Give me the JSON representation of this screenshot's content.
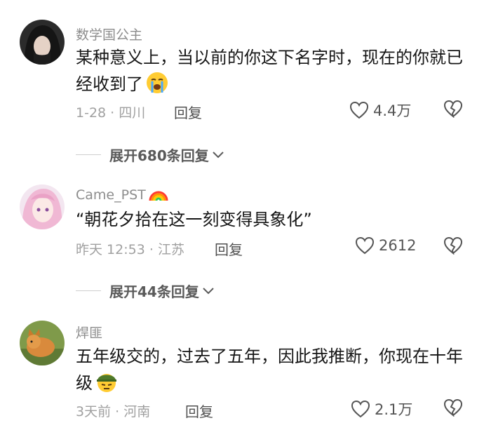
{
  "comments": [
    {
      "username": "数学国公主",
      "text": "某种意义上，当以前的你这下名字时，现在的你就已经收到了",
      "emoji": "crying-face-icon",
      "date": "1-28",
      "location": "四川",
      "reply_label": "回复",
      "likes": "4.4万",
      "expand_label": "展开680条回复"
    },
    {
      "username": "Came_PST",
      "username_emoji": "rainbow-icon",
      "text": "“朝花夕拾在这一刻变得具象化”",
      "date": "昨天 12:53",
      "location": "江苏",
      "reply_label": "回复",
      "likes": "2612",
      "expand_label": "展开44条回复"
    },
    {
      "username": "焊匪",
      "text": "五年级交的，过去了五年，因此我推断，你现在十年级",
      "emoji": "soldier-face-icon",
      "date": "3天前",
      "location": "河南",
      "reply_label": "回复",
      "likes": "2.1万"
    }
  ],
  "colors": {
    "username": "#8d8d8d",
    "meta": "#a0a0a0",
    "text": "#161616"
  }
}
